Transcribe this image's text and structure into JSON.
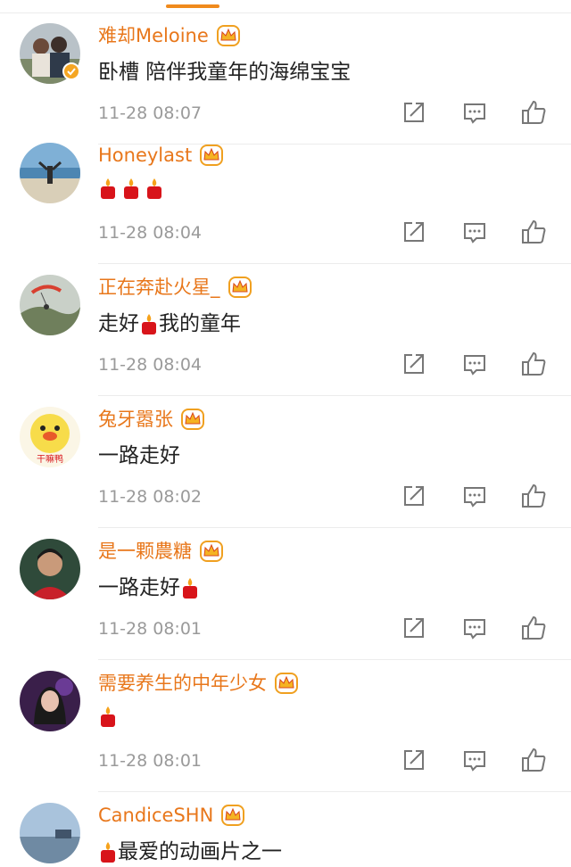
{
  "colors": {
    "username": "#e8771b",
    "accent": "#f08a1c",
    "text": "#222222",
    "meta": "#9a9a9a"
  },
  "comments": [
    {
      "username": "难却Meloine",
      "text_before": "卧槽   陪伴我童年的海绵宝宝",
      "candles_after": 0,
      "text_after": "",
      "time": "11-28 08:07",
      "verified": true,
      "avatar": "avatar-photo-people"
    },
    {
      "username": "Honeylast",
      "text_before": "",
      "candles_after": 3,
      "text_after": "",
      "time": "11-28 08:04",
      "verified": false,
      "avatar": "avatar-photo-beach"
    },
    {
      "username": "正在奔赴火星_",
      "text_before": "走好",
      "candles_after": 1,
      "text_after": "我的童年",
      "time": "11-28 08:04",
      "verified": false,
      "avatar": "avatar-photo-paraglider"
    },
    {
      "username": "兔牙嚣张",
      "text_before": "一路走好",
      "candles_after": 0,
      "text_after": "",
      "time": "11-28 08:02",
      "verified": false,
      "avatar": "avatar-cartoon-duck"
    },
    {
      "username": "是一颗農糖",
      "text_before": "一路走好",
      "candles_after": 1,
      "text_after": "",
      "time": "11-28 08:01",
      "verified": false,
      "avatar": "avatar-photo-person"
    },
    {
      "username": "需要养生的中年少女",
      "text_before": "",
      "candles_after": 1,
      "text_after": "",
      "time": "11-28 08:01",
      "verified": false,
      "avatar": "avatar-photo-girl"
    },
    {
      "username": "CandiceSHN",
      "text_before": "",
      "candles_after": 1,
      "text_after": "最爱的动画片之一",
      "time": "",
      "verified": false,
      "avatar": "avatar-photo-landscape"
    }
  ],
  "icons": {
    "share": "share-icon",
    "reply": "comment-icon",
    "like": "thumbs-up-icon",
    "badge": "crown-icon",
    "emoji": "candle-icon"
  },
  "duck_avatar_text": "干嘛鸭"
}
